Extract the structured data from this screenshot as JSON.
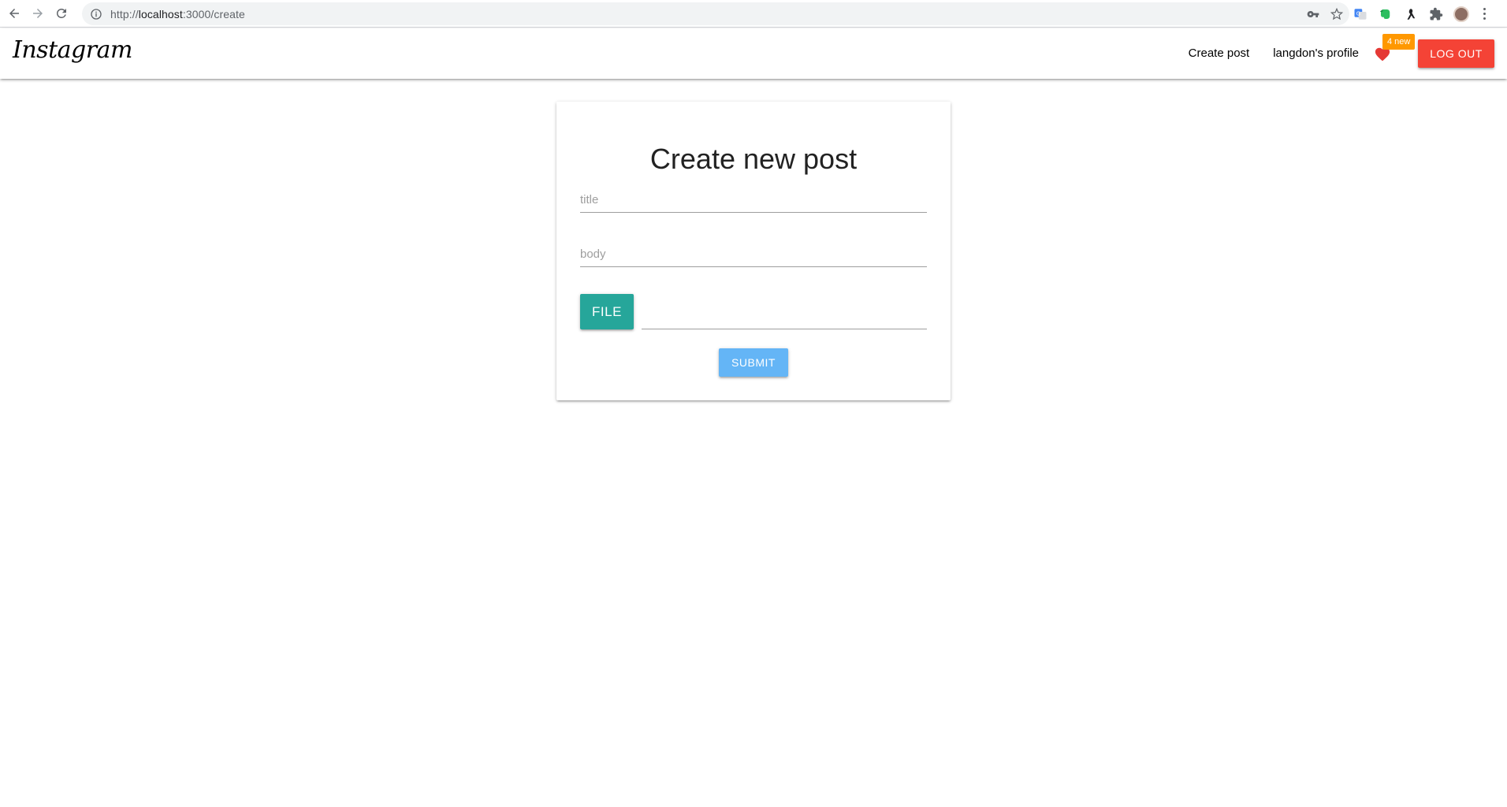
{
  "browser": {
    "url_prefix": "http://",
    "url_host": "localhost",
    "url_rest": ":3000/create",
    "icons": [
      "back-arrow-icon",
      "forward-arrow-icon",
      "reload-icon",
      "info-icon",
      "key-icon",
      "star-icon",
      "translate-icon",
      "evernote-icon",
      "bird-icon",
      "puzzle-icon",
      "avatar",
      "menu-icon"
    ]
  },
  "navbar": {
    "brand": "Instagram",
    "create_post": "Create post",
    "profile": "langdon's profile",
    "badge": "4 new",
    "logout": "LOG OUT",
    "colors": {
      "heart": "#e53935",
      "badge": "#ff9800",
      "logout": "#f44336"
    }
  },
  "form": {
    "heading": "Create new post",
    "title_placeholder": "title",
    "body_placeholder": "body",
    "file_label": "FILE",
    "submit_label": "SUBMIT",
    "colors": {
      "file": "#26a69a",
      "submit": "#64b5f6"
    }
  }
}
